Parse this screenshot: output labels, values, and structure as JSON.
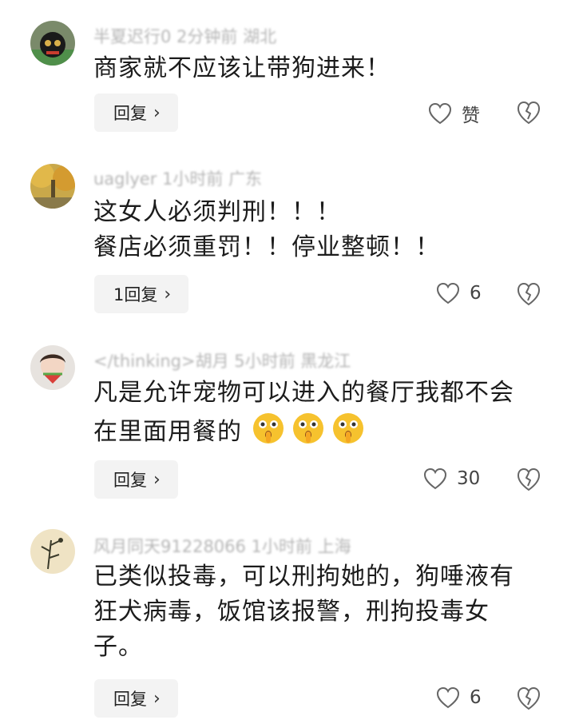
{
  "comments": [
    {
      "meta": "半夏迟行0 2分钟前 湖北",
      "text_lines": [
        "商家就不应该让带狗进来！"
      ],
      "reply_label": "回复",
      "like_text": "赞",
      "avatar_icon": "avatar-dark-figure-icon"
    },
    {
      "meta": "uaglyer 1小时前 广东",
      "text_lines": [
        "这女人必须判刑！！！",
        "餐店必须重罚！！停业整顿！！"
      ],
      "reply_label": "1回复",
      "like_text": "6",
      "avatar_icon": "avatar-autumn-tree-icon"
    },
    {
      "meta": "</thinking>胡月 5小时前 黑龙江",
      "text_lines": [
        "凡是允许宠物可以进入的餐厅我都不会",
        "在里面用餐的"
      ],
      "emoji_count": 3,
      "reply_label": "回复",
      "like_text": "30",
      "avatar_icon": "avatar-girl-watermelon-icon"
    },
    {
      "meta": "风月同天91228066 1小时前 上海",
      "text_lines": [
        "已类似投毒，可以刑拘她的，狗唾液有",
        "狂犬病毒，饭馆该报警，刑拘投毒女",
        "子。"
      ],
      "reply_label": "回复",
      "like_text": "6",
      "avatar_icon": "avatar-bamboo-painting-icon"
    }
  ],
  "colors": {
    "background": "#ffffff",
    "reply_bg": "#f3f3f3",
    "text": "#1c1c1c",
    "meta": "#b5b5b5"
  }
}
